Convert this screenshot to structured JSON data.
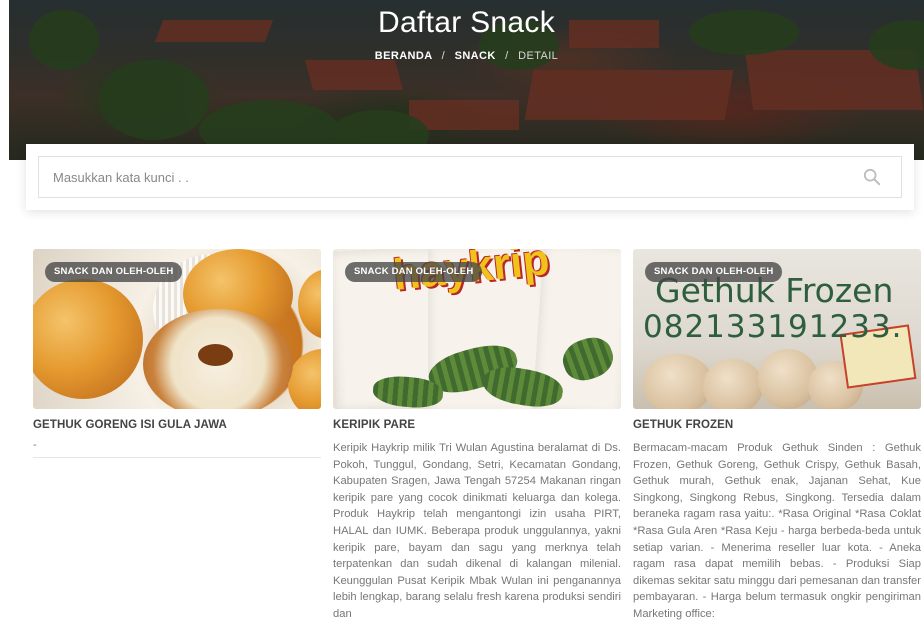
{
  "hero": {
    "title": "Daftar Snack",
    "breadcrumb": {
      "home": "BERANDA",
      "section": "SNACK",
      "current": "DETAIL",
      "separator": "/"
    }
  },
  "search": {
    "placeholder": "Masukkan kata kunci . .",
    "value": "",
    "icon": "search-icon"
  },
  "cards": [
    {
      "category": "SNACK DAN OLEH-OLEH",
      "title": "GETHUK GORENG ISI GULA JAWA",
      "description": "-"
    },
    {
      "category": "SNACK DAN OLEH-OLEH",
      "title": "KERIPIK PARE",
      "logo_text": "haykrip",
      "description": "Keripik Haykrip milik Tri Wulan Agustina beralamat di Ds. Pokoh, Tunggul, Gondang, Setri, Kecamatan Gondang, Kabupaten Sragen, Jawa Tengah 57254 Makanan ringan keripik pare yang cocok dinikmati keluarga dan kolega. Produk Haykrip telah mengantongi izin usaha PIRT, HALAL dan IUMK. Beberapa produk unggulannya, yakni keripik pare, bayam dan sagu yang merknya telah terpatenkan dan sudah dikenal di kalangan milenial. Keunggulan Pusat Keripik Mbak Wulan ini penganannya lebih lengkap, barang selalu fresh karena produksi sendiri dan"
    },
    {
      "category": "SNACK DAN OLEH-OLEH",
      "title": "GETHUK FROZEN",
      "image_text": [
        "Gethuk Frozen",
        "082133191233."
      ],
      "description": "Bermacam-macam Produk Gethuk Sinden : Gethuk Frozen, Gethuk Goreng, Gethuk Crispy, Gethuk Basah, Gethuk murah, Gethuk enak, Jajanan Sehat, Kue Singkong, Singkong Rebus, Singkong. Tersedia dalam beraneka ragam rasa yaitu:. *Rasa Original *Rasa Coklat *Rasa Gula Aren *Rasa Keju - harga berbeda-beda untuk setiap varian. - Menerima reseller luar kota. - Aneka ragam rasa dapat memilih bebas. - Produksi Siap dikemas sekitar satu minggu dari pemesanan dan transfer pembayaran. - Harga belum termasuk ongkir pengiriman Marketing office:"
    }
  ],
  "colors": {
    "hero_text": "#ffffff",
    "badge_bg": "#464646",
    "title_text": "#444444",
    "body_text": "#777777"
  }
}
